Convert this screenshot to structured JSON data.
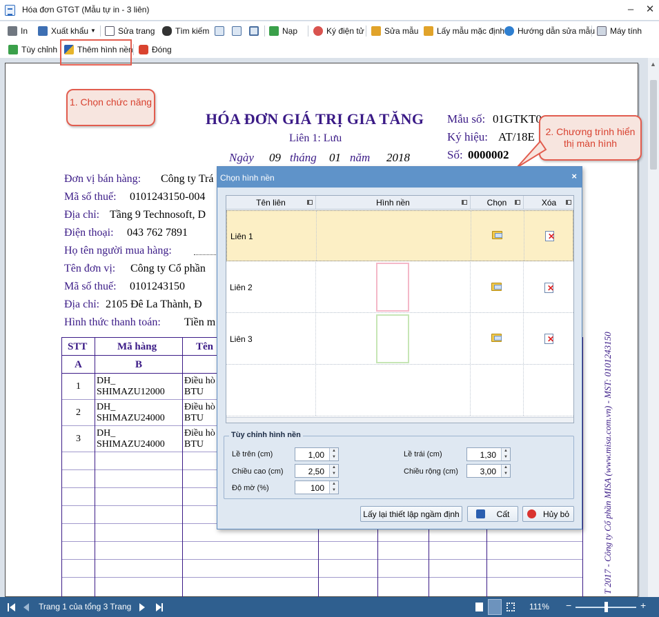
{
  "window": {
    "title": "Hóa đơn GTGT (Mẫu tự in - 3 liên)",
    "minimize": "‒",
    "maximize": "□",
    "close": "✕"
  },
  "toolbar1": [
    {
      "label": "In",
      "icon": "printer-icon"
    },
    {
      "label": "Xuất khẩu",
      "icon": "export-icon"
    },
    {
      "label": "Sửa trang",
      "icon": "edit-page-icon"
    },
    {
      "label": "Tìm kiếm",
      "icon": "binoculars-icon"
    },
    {
      "label": "Nạp",
      "icon": "refresh-icon"
    },
    {
      "label": "Ký điện tử",
      "icon": "digital-sign-icon"
    },
    {
      "label": "Sửa mẫu",
      "icon": "edit-template-icon"
    },
    {
      "label": "Lấy mẫu mặc định",
      "icon": "default-template-icon"
    },
    {
      "label": "Hướng dẫn sửa mẫu",
      "icon": "help-icon"
    },
    {
      "label": "Máy tính",
      "icon": "calculator-icon"
    }
  ],
  "toolbar2": [
    {
      "label": "Tùy chỉnh",
      "icon": "customize-icon"
    },
    {
      "label": "Thêm hình nền",
      "icon": "add-background-icon"
    },
    {
      "label": "Đóng",
      "icon": "close-red-icon"
    }
  ],
  "callouts": {
    "step1": "1. Chọn chức năng",
    "step2": "2. Chương trình hiển thị màn hình"
  },
  "invoice": {
    "title": "HÓA ĐƠN GIÁ TRỊ GIA TĂNG",
    "copy": "Liên 1: Lưu",
    "date": {
      "ngay_label": "Ngày",
      "day": "09",
      "thang_label": "tháng",
      "month": "01",
      "nam_label": "năm",
      "year": "2018"
    },
    "mau_so_label": "Mẫu số:",
    "mau_so": "01GTKT0",
    "ky_hieu_label": "Ký hiệu:",
    "ky_hieu": "AT/18E",
    "so_label": "Số:",
    "so": "0000002",
    "seller_label": "Đơn vị bán hàng:",
    "seller": "Công ty Trá",
    "seller_tax_label": "Mã số thuế:",
    "seller_tax": "0101243150-004",
    "seller_addr_label": "Địa chỉ:",
    "seller_addr": "Tầng 9 Technosoft, D",
    "phone_label": "Điện thoại:",
    "phone": "043 762 7891",
    "buyer_name_label": "Họ tên người mua hàng:",
    "buyer_unit_label": "Tên đơn vị:",
    "buyer_unit": "Công ty Cổ phần",
    "buyer_tax_label": "Mã số thuế:",
    "buyer_tax": "0101243150",
    "buyer_addr_label": "Địa chỉ:",
    "buyer_addr": "2105 Đê La Thành, Đ",
    "payment_label": "Hình thức thanh toán:",
    "payment": "Tiền m",
    "table": {
      "headers": [
        "STT",
        "Mã hàng",
        "Tên"
      ],
      "subheaders": [
        "A",
        "B"
      ],
      "rows": [
        {
          "stt": "1",
          "code1": "DH_",
          "code2": "SHIMAZU12000",
          "name1": "Điều hò",
          "name2": "BTU"
        },
        {
          "stt": "2",
          "code1": "DH_",
          "code2": "SHIMAZU24000",
          "name1": "Điều hò",
          "name2": "BTU"
        },
        {
          "stt": "3",
          "code1": "DH_",
          "code2": "SHIMAZU24000",
          "name1": "Điều hò",
          "name2": "BTU"
        }
      ]
    },
    "side_text": "T 2017 - Công ty Cổ phần MISA (www.misa.com.vn) - MST: 0101243150"
  },
  "dialog": {
    "title": "Chọn hình nền",
    "close": "×",
    "columns": [
      "Tên liên",
      "Hình nền",
      "Chọn",
      "Xóa"
    ],
    "rows": [
      {
        "name": "Liên 1",
        "selected": true,
        "thumb_color": ""
      },
      {
        "name": "Liên 2",
        "selected": false,
        "thumb_color": "#f4b8c8"
      },
      {
        "name": "Liên 3",
        "selected": false,
        "thumb_color": "#c6e6b5"
      }
    ],
    "group_title": "Tùy chỉnh hình nền",
    "fields": {
      "top_label": "Lề trên (cm)",
      "top": "1,00",
      "left_label": "Lề trái (cm)",
      "left": "1,30",
      "height_label": "Chiều cao  (cm)",
      "height": "2,50",
      "width_label": "Chiều rộng (cm)",
      "width": "3,00",
      "opacity_label": "Độ mờ (%)",
      "opacity": "100"
    },
    "buttons": {
      "reset": "Lấy lại thiết lập ngầm định",
      "save": "Cất",
      "cancel": "Hủy bỏ"
    }
  },
  "statusbar": {
    "page_info": "Trang 1 của tổng 3 Trang",
    "zoom": "111%"
  },
  "colors": {
    "accent": "#3a1a86",
    "dialog_header": "#5f93c9",
    "status": "#2f5f8f",
    "callout": "#e25c4e"
  }
}
